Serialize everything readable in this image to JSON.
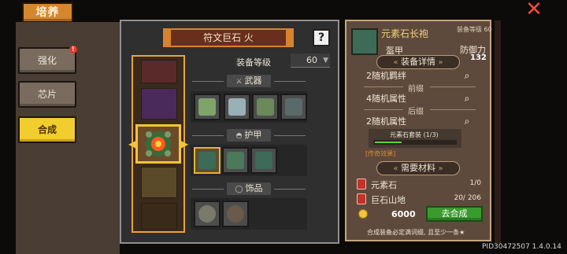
{
  "header": {
    "title": "培养",
    "close_glyph": "✕"
  },
  "nav": {
    "items": [
      {
        "label": "强化",
        "badge": "!"
      },
      {
        "label": "芯片"
      },
      {
        "label": "合成",
        "active": true
      }
    ]
  },
  "rune": {
    "title": "符文巨石 火",
    "help": "?"
  },
  "equip_level": {
    "label": "装备等级",
    "value": "60"
  },
  "categories": {
    "weapon": {
      "label": "武器",
      "icon": "sword-icon"
    },
    "armor": {
      "label": "护甲",
      "icon": "helmet-icon"
    },
    "accessory": {
      "label": "饰品",
      "icon": "ring-icon"
    }
  },
  "detail": {
    "item_name": "元素石长袍",
    "equip_level_small": "装备等级 60",
    "item_type": "盔甲",
    "defense_label": "防御力",
    "defense_value": "132",
    "section_details": "装备详情",
    "rows": {
      "random_halo": "2随机羁绊",
      "front_slot": "前缀",
      "random_attr_4": "4随机属性",
      "back_slot": "后缀",
      "random_attr_2": "2随机属性"
    },
    "set_label": "元素石套装 (1/3)",
    "set_progress": 0.33,
    "legend_tag": "[传奇效果]",
    "section_materials": "需要材料",
    "materials": [
      {
        "name": "元素石",
        "count": "1/0"
      },
      {
        "name": "巨石山地",
        "count": "20/ 206"
      }
    ],
    "cost": "6000",
    "craft_label": "去合成",
    "footer_note": "合成装备必定满词缀, 且至少一条★"
  },
  "version": "PID30472507 1.4.0.14",
  "colors": {
    "accent_gold": "#f3c43a",
    "craft_green": "#3a9a2e",
    "close_red": "#ef4a3f"
  }
}
